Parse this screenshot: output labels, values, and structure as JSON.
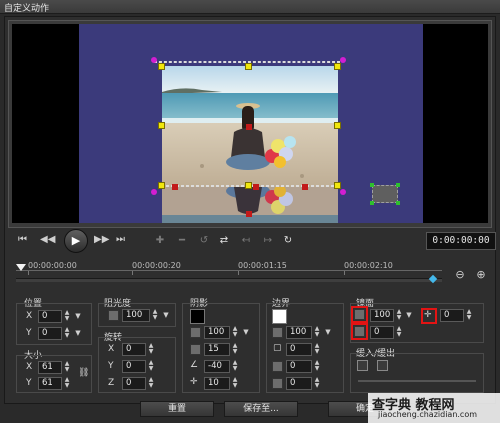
{
  "window": {
    "title": "自定义动作"
  },
  "timecode": "0:00:00:00",
  "ruler": {
    "labels": [
      "00:00:00:00",
      "00:00:00:20",
      "00:00:01:15",
      "00:00:02:10"
    ],
    "progress": 0
  },
  "position": {
    "label": "位置",
    "x_axis": "X",
    "x": "0",
    "y_axis": "Y",
    "y": "0"
  },
  "size": {
    "label": "大小",
    "x_axis": "X",
    "x": "61",
    "y_axis": "Y",
    "y": "61"
  },
  "opacity": {
    "label": "阻光度",
    "value": "100"
  },
  "rotation": {
    "label": "旋转",
    "x_axis": "X",
    "x": "0",
    "y_axis": "Y",
    "y": "0",
    "z_axis": "Z",
    "z": "0"
  },
  "shadow": {
    "label": "阴影",
    "color": "#000000",
    "opacity": "100",
    "blur": "15",
    "angle": "-40",
    "distance": "10"
  },
  "border": {
    "label": "边界",
    "color": "#ffffff",
    "opacity": "100",
    "width": "0",
    "blur": "0",
    "radius": "0"
  },
  "mirror": {
    "label": "镜面",
    "opacity": "100",
    "fade": "0",
    "offset": "0"
  },
  "ease": {
    "label": "缓入/缓出"
  },
  "footer": {
    "reset": "重置",
    "save_to": "保存至...",
    "ok": "确定"
  },
  "watermark": {
    "site": "查字典",
    "section": "教程网",
    "url": "jiaocheng.chazidian.com"
  },
  "colors": {
    "canvas": "#3b3a7b",
    "handle": "#f1e70d",
    "highlight": "#e21414",
    "keyframe": "#44b8ea"
  },
  "icons": {
    "transport": [
      "skip-start-icon",
      "prev-frame-icon",
      "play-icon",
      "next-frame-icon",
      "skip-end-icon"
    ],
    "tools": [
      "add-keyframe-icon",
      "remove-keyframe-icon",
      "reverse-icon",
      "swap-icon",
      "move-left-icon",
      "move-right-icon",
      "reset-icon"
    ]
  }
}
